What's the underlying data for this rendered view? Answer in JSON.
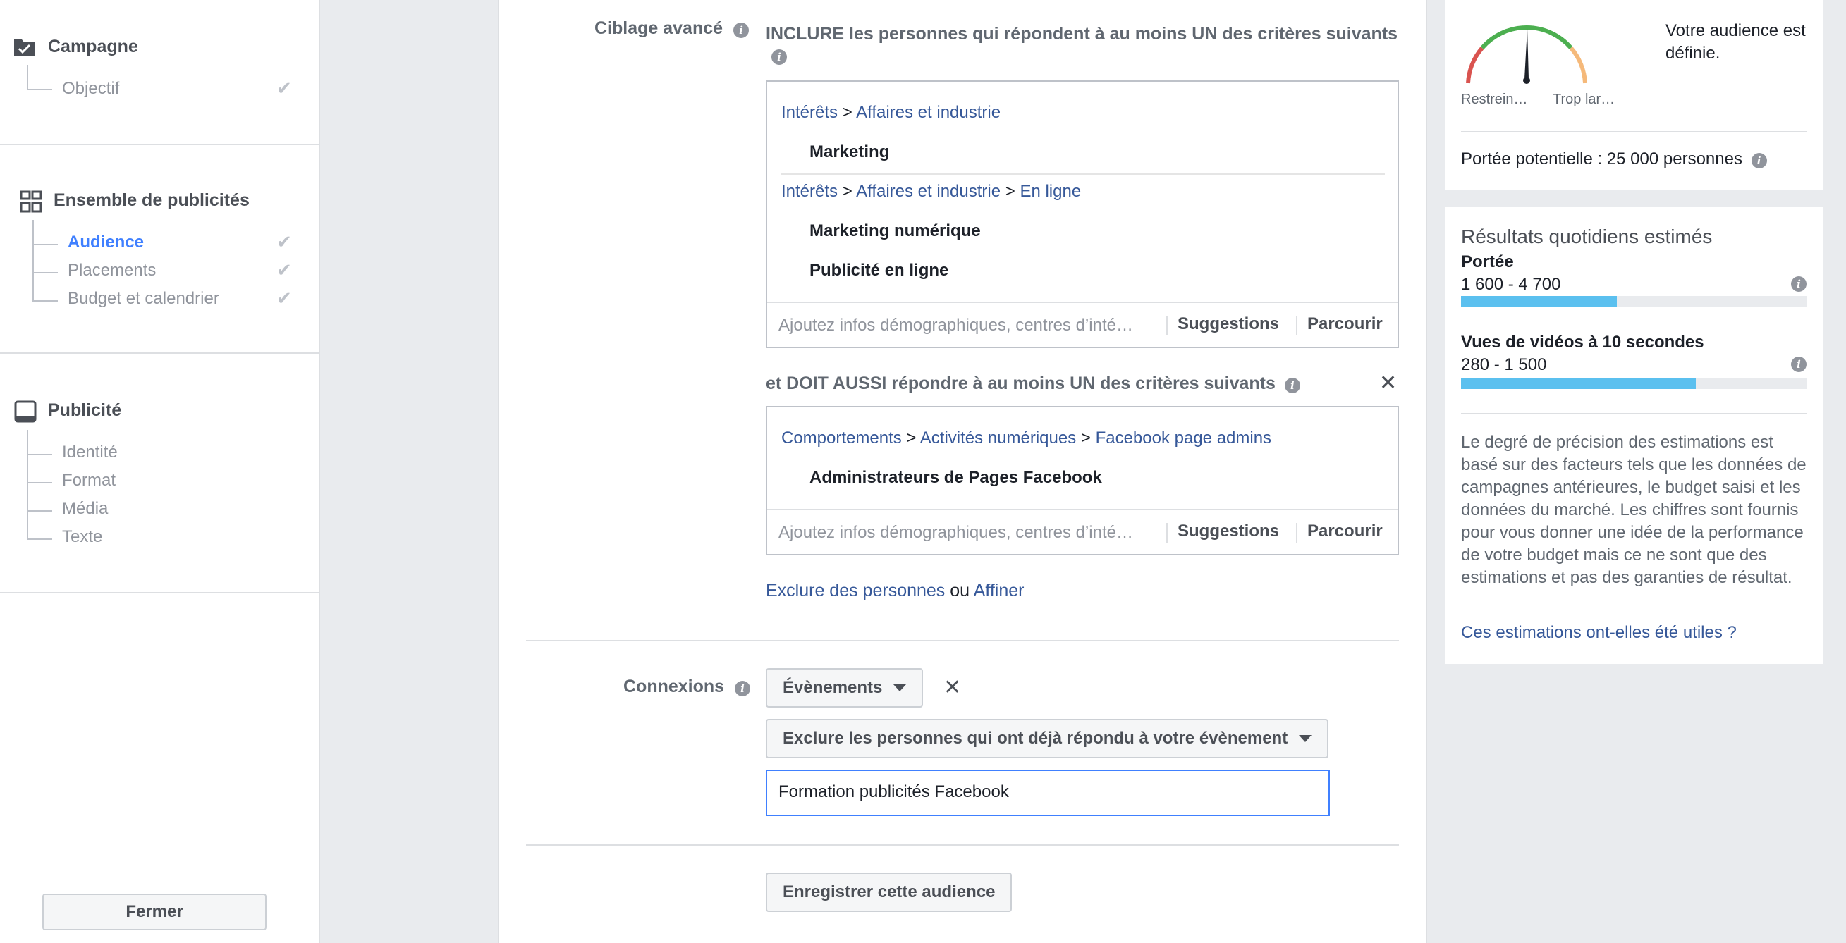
{
  "sidebar": {
    "campaign": {
      "title": "Campagne",
      "items": [
        {
          "label": "Objectif"
        }
      ]
    },
    "adset": {
      "title": "Ensemble de publicités",
      "items": [
        {
          "label": "Audience"
        },
        {
          "label": "Placements"
        },
        {
          "label": "Budget et calendrier"
        }
      ]
    },
    "ad": {
      "title": "Publicité",
      "items": [
        {
          "label": "Identité"
        },
        {
          "label": "Format"
        },
        {
          "label": "Média"
        },
        {
          "label": "Texte"
        }
      ]
    },
    "close_label": "Fermer"
  },
  "targeting": {
    "label": "Ciblage avancé",
    "include_text": "INCLURE les personnes qui répondent à au moins UN des critères suivants",
    "include_box": {
      "path1": {
        "root": "Intérêts",
        "sub": "Affaires et industrie"
      },
      "item1": "Marketing",
      "path2": {
        "root": "Intérêts",
        "sub": "Affaires et industrie",
        "leaf": "En ligne"
      },
      "item2": "Marketing numérique",
      "item3": "Publicité en ligne",
      "placeholder": "Ajoutez infos démographiques, centres d’inté…",
      "suggestions": "Suggestions",
      "browse": "Parcourir"
    },
    "narrow_text": "et DOIT AUSSI répondre à au moins UN des critères suivants",
    "narrow_box": {
      "path": {
        "root": "Comportements",
        "sub": "Activités numériques",
        "leaf": "Facebook page admins"
      },
      "item": "Administrateurs de Pages Facebook",
      "placeholder": "Ajoutez infos démographiques, centres d’inté…",
      "suggestions": "Suggestions",
      "browse": "Parcourir"
    },
    "exclude_link": "Exclure des personnes",
    "or_text": "ou",
    "refine_link": "Affiner",
    "separator": ">"
  },
  "connections": {
    "label": "Connexions",
    "type_dropdown": "Évènements",
    "exclude_dropdown": "Exclure les personnes qui ont déjà répondu à votre évènement",
    "event_input": "Formation publicités Facebook"
  },
  "save_button": "Enregistrer cette audience",
  "gauge": {
    "left_label": "Restrein…",
    "right_label": "Trop lar…",
    "status": "Votre audience est définie.",
    "potential_reach": "Portée potentielle : 25 000 personnes"
  },
  "daily_results": {
    "title": "Résultats quotidiens estimés",
    "reach": {
      "label": "Portée",
      "range": "1 600 - 4 700",
      "fill": 0.45
    },
    "video_views": {
      "label": "Vues de vidéos à 10 secondes",
      "range": "280 - 1 500",
      "fill": 0.68
    },
    "disclaimer": "Le degré de précision des estimations est basé sur des facteurs tels que les données de campagnes antérieures, le budget saisi et les données du marché. Les chiffres sont fournis pour vous donner une idée de la performance de votre budget mais ce ne sont que des estimations et pas des garanties de résultat.",
    "feedback_link": "Ces estimations ont-elles été utiles ?"
  },
  "colors": {
    "link": "#365899",
    "active": "#4080ff",
    "bar": "#5bc0ef",
    "gauge_green": "#4caf50",
    "gauge_red": "#d9534f",
    "gauge_orange": "#f5b97a"
  }
}
